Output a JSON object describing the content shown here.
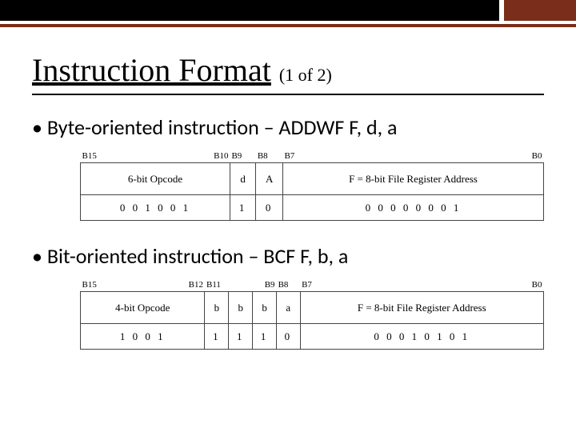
{
  "header": {
    "title": "Instruction Format",
    "pager": "(1 of 2)"
  },
  "byte": {
    "bullet": "• Byte-oriented instruction – ADDWF  F, d, a",
    "labels": {
      "b15": "B15",
      "b10": "B10",
      "b9": "B9",
      "b8": "B8",
      "b7": "B7",
      "b0": "B0"
    },
    "desc": {
      "opcode": "6-bit Opcode",
      "d": "d",
      "a": "A",
      "f": "F = 8-bit File Register Address"
    },
    "bits": {
      "opcode": "0 0 1 0   0 1",
      "d": "1",
      "a": "0",
      "f": "0 0 0 0   0 0 0 1"
    }
  },
  "bit": {
    "bullet": "• Bit-oriented instruction – BCF  F, b, a",
    "labels": {
      "b15": "B15",
      "b12": "B12",
      "b11": "B11",
      "b9": "B9",
      "b8": "B8",
      "b7": "B7",
      "b0": "B0"
    },
    "desc": {
      "opcode": "4-bit Opcode",
      "b": "b",
      "a": "a",
      "f": "F = 8-bit File Register Address"
    },
    "bits": {
      "opcode": "1 0 0 1",
      "b1": "1",
      "b2": "1",
      "b3": "1",
      "a": "0",
      "f": "0 0 0 1   0 1 0 1"
    }
  },
  "chart_data": [
    {
      "type": "table",
      "title": "Byte-oriented instruction format (ADDWF F,d,a)",
      "fields": [
        {
          "name": "6-bit Opcode",
          "bits": "B15-B10",
          "value": "001001"
        },
        {
          "name": "d",
          "bits": "B9",
          "value": "1"
        },
        {
          "name": "A",
          "bits": "B8",
          "value": "0"
        },
        {
          "name": "F = 8-bit File Register Address",
          "bits": "B7-B0",
          "value": "00000001"
        }
      ]
    },
    {
      "type": "table",
      "title": "Bit-oriented instruction format (BCF F,b,a)",
      "fields": [
        {
          "name": "4-bit Opcode",
          "bits": "B15-B12",
          "value": "1001"
        },
        {
          "name": "b",
          "bits": "B11-B9",
          "value": "111"
        },
        {
          "name": "a",
          "bits": "B8",
          "value": "0"
        },
        {
          "name": "F = 8-bit File Register Address",
          "bits": "B7-B0",
          "value": "00010101"
        }
      ]
    }
  ]
}
